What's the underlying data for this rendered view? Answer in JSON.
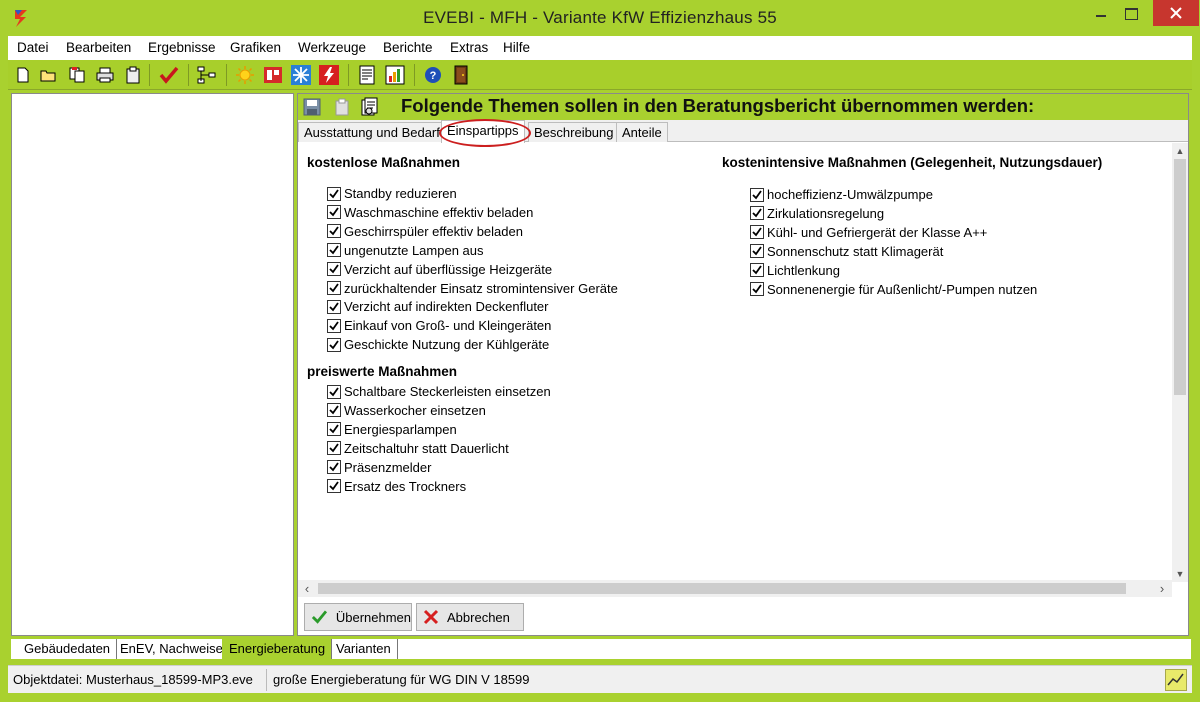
{
  "window": {
    "title": "EVEBI - MFH - Variante KfW Effizienzhaus 55"
  },
  "menu": {
    "items": [
      "Datei",
      "Bearbeiten",
      "Ergebnisse",
      "Grafiken",
      "Werkzeuge",
      "Berichte",
      "Extras",
      "Hilfe"
    ]
  },
  "toolbar": {
    "icons": [
      "new-document-icon",
      "open-folder-icon",
      "copy-icon",
      "print-icon",
      "clipboard-icon",
      "check-icon",
      "network-icon",
      "sun-icon",
      "window-icon",
      "snowflake-icon",
      "lightning-icon",
      "report-icon",
      "chart-report-icon",
      "help-icon",
      "door-icon"
    ]
  },
  "panel": {
    "title": "Folgende Themen sollen in den Beratungsbericht übernommen werden:",
    "tabs": [
      "Ausstattung und Bedarf",
      "Einspartipps",
      "Beschreibung",
      "Anteile"
    ],
    "active_tab": "Einspartipps"
  },
  "groups": {
    "kostenlos": {
      "title": "kostenlose Maßnahmen",
      "items": [
        "Standby reduzieren",
        "Waschmaschine effektiv beladen",
        "Geschirrspüler effektiv beladen",
        "ungenutzte Lampen aus",
        "Verzicht auf überflüssige Heizgeräte",
        "zurückhaltender Einsatz stromintensiver Geräte",
        "Verzicht auf indirekten Deckenfluter",
        "Einkauf von Groß- und Kleingeräten",
        "Geschickte Nutzung der Kühlgeräte"
      ]
    },
    "preiswert": {
      "title": "preiswerte Maßnahmen",
      "items": [
        "Schaltbare Steckerleisten einsetzen",
        "Wasserkocher einsetzen",
        "Energiesparlampen",
        "Zeitschaltuhr statt Dauerlicht",
        "Präsenzmelder",
        "Ersatz des Trockners"
      ]
    },
    "kostenintensiv": {
      "title": "kostenintensive Maßnahmen (Gelegenheit, Nutzungsdauer)",
      "items": [
        "hocheffizienz-Umwälzpumpe",
        "Zirkulationsregelung",
        "Kühl- und Gefriergerät der Klasse A++",
        "Sonnenschutz statt Klimagerät",
        "Lichtlenkung",
        "Sonnenenergie für Außenlicht/-Pumpen nutzen"
      ]
    }
  },
  "buttons": {
    "apply": "Übernehmen",
    "cancel": "Abbrechen"
  },
  "bottom_tabs": [
    "Gebäudedaten",
    "EnEV, Nachweise",
    "Energieberatung",
    "Varianten"
  ],
  "bottom_active": "Energieberatung",
  "status": {
    "file": "Objektdatei: Musterhaus_18599-MP3.eve",
    "mode": "große Energieberatung für WG DIN V 18599"
  },
  "colors": {
    "accent": "#a9d12f",
    "highlight_oval": "#cc1f1f",
    "close_button": "#c7362e"
  }
}
